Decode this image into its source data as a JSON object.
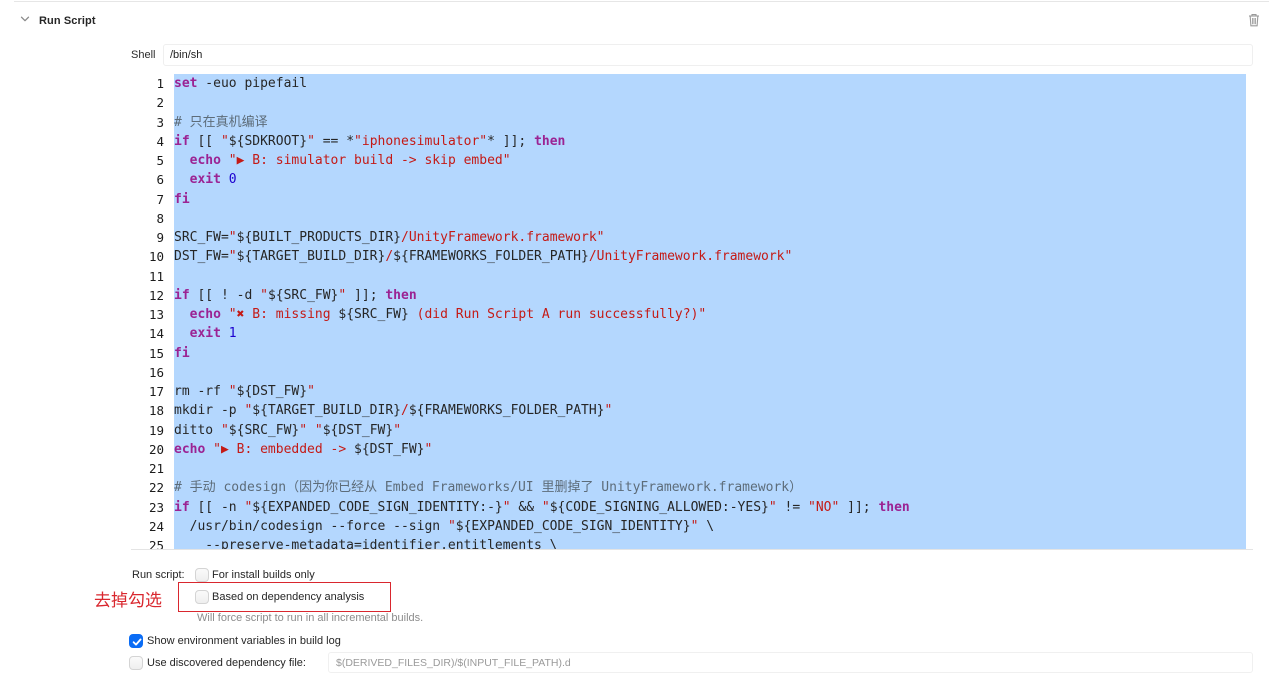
{
  "phase": {
    "title": "Run Script"
  },
  "shell": {
    "label": "Shell",
    "value": "/bin/sh"
  },
  "editor": {
    "lines": [
      [
        {
          "t": "set",
          "c": "kw"
        },
        {
          "t": " -euo pipefail"
        }
      ],
      [],
      [
        {
          "t": "# 只在真机编译",
          "c": "cmt"
        }
      ],
      [
        {
          "t": "if",
          "c": "kw"
        },
        {
          "t": " [[ "
        },
        {
          "t": "\"",
          "c": "str"
        },
        {
          "t": "${SDKROOT}"
        },
        {
          "t": "\"",
          "c": "str"
        },
        {
          "t": " == *"
        },
        {
          "t": "\"iphonesimulator\"",
          "c": "str"
        },
        {
          "t": "* ]]; "
        },
        {
          "t": "then",
          "c": "kw"
        }
      ],
      [
        {
          "t": "  "
        },
        {
          "t": "echo",
          "c": "kw"
        },
        {
          "t": " "
        },
        {
          "t": "\"▶ B: simulator build -> skip embed\"",
          "c": "str"
        }
      ],
      [
        {
          "t": "  "
        },
        {
          "t": "exit",
          "c": "kw"
        },
        {
          "t": " "
        },
        {
          "t": "0",
          "c": "num"
        }
      ],
      [
        {
          "t": "fi",
          "c": "kw"
        }
      ],
      [],
      [
        {
          "t": "SRC_FW="
        },
        {
          "t": "\"",
          "c": "str"
        },
        {
          "t": "${BUILT_PRODUCTS_DIR}"
        },
        {
          "t": "/UnityFramework.framework\"",
          "c": "str"
        }
      ],
      [
        {
          "t": "DST_FW="
        },
        {
          "t": "\"",
          "c": "str"
        },
        {
          "t": "${TARGET_BUILD_DIR}"
        },
        {
          "t": "/",
          "c": "str"
        },
        {
          "t": "${FRAMEWORKS_FOLDER_PATH}"
        },
        {
          "t": "/UnityFramework.framework\"",
          "c": "str"
        }
      ],
      [],
      [
        {
          "t": "if",
          "c": "kw"
        },
        {
          "t": " [[ ! -d "
        },
        {
          "t": "\"",
          "c": "str"
        },
        {
          "t": "${SRC_FW}"
        },
        {
          "t": "\"",
          "c": "str"
        },
        {
          "t": " ]]; "
        },
        {
          "t": "then",
          "c": "kw"
        }
      ],
      [
        {
          "t": "  "
        },
        {
          "t": "echo",
          "c": "kw"
        },
        {
          "t": " "
        },
        {
          "t": "\"✖ B: missing ",
          "c": "str"
        },
        {
          "t": "${SRC_FW}"
        },
        {
          "t": " (did Run Script A run successfully?)\"",
          "c": "str"
        }
      ],
      [
        {
          "t": "  "
        },
        {
          "t": "exit",
          "c": "kw"
        },
        {
          "t": " "
        },
        {
          "t": "1",
          "c": "num"
        }
      ],
      [
        {
          "t": "fi",
          "c": "kw"
        }
      ],
      [],
      [
        {
          "t": "rm -rf "
        },
        {
          "t": "\"",
          "c": "str"
        },
        {
          "t": "${DST_FW}"
        },
        {
          "t": "\"",
          "c": "str"
        }
      ],
      [
        {
          "t": "mkdir -p "
        },
        {
          "t": "\"",
          "c": "str"
        },
        {
          "t": "${TARGET_BUILD_DIR}"
        },
        {
          "t": "/",
          "c": "str"
        },
        {
          "t": "${FRAMEWORKS_FOLDER_PATH}"
        },
        {
          "t": "\"",
          "c": "str"
        }
      ],
      [
        {
          "t": "ditto "
        },
        {
          "t": "\"",
          "c": "str"
        },
        {
          "t": "${SRC_FW}"
        },
        {
          "t": "\"",
          "c": "str"
        },
        {
          "t": " "
        },
        {
          "t": "\"",
          "c": "str"
        },
        {
          "t": "${DST_FW}"
        },
        {
          "t": "\"",
          "c": "str"
        }
      ],
      [
        {
          "t": "echo",
          "c": "kw"
        },
        {
          "t": " "
        },
        {
          "t": "\"▶ B: embedded -> ",
          "c": "str"
        },
        {
          "t": "${DST_FW}"
        },
        {
          "t": "\"",
          "c": "str"
        }
      ],
      [],
      [
        {
          "t": "# 手动 codesign（因为你已经从 Embed Frameworks/UI 里删掉了 UnityFramework.framework）",
          "c": "cmt"
        }
      ],
      [
        {
          "t": "if",
          "c": "kw"
        },
        {
          "t": " [[ -n "
        },
        {
          "t": "\"",
          "c": "str"
        },
        {
          "t": "${EXPANDED_CODE_SIGN_IDENTITY:-}"
        },
        {
          "t": "\"",
          "c": "str"
        },
        {
          "t": " && "
        },
        {
          "t": "\"",
          "c": "str"
        },
        {
          "t": "${CODE_SIGNING_ALLOWED:-YES}"
        },
        {
          "t": "\"",
          "c": "str"
        },
        {
          "t": " != "
        },
        {
          "t": "\"NO\"",
          "c": "str"
        },
        {
          "t": " ]]; "
        },
        {
          "t": "then",
          "c": "kw"
        }
      ],
      [
        {
          "t": "  /usr/bin/codesign --force --sign "
        },
        {
          "t": "\"",
          "c": "str"
        },
        {
          "t": "${EXPANDED_CODE_SIGN_IDENTITY}"
        },
        {
          "t": "\"",
          "c": "str"
        },
        {
          "t": " \\"
        }
      ],
      [
        {
          "t": "    --preserve-metadata=identifier,entitlements \\"
        }
      ]
    ]
  },
  "options": {
    "run_script_label": "Run script:",
    "install_builds_label": "For install builds only",
    "install_builds_checked": false,
    "dependency_analysis_label": "Based on dependency analysis",
    "dependency_analysis_checked": false,
    "dependency_hint": "Will force script to run in all incremental builds.",
    "show_env_label": "Show environment variables in build log",
    "show_env_checked": true,
    "use_dep_file_label": "Use discovered dependency file:",
    "use_dep_file_checked": false,
    "dep_file_placeholder": "$(DERIVED_FILES_DIR)/$(INPUT_FILE_PATH).d"
  },
  "annotation": {
    "text": "去掉勾选",
    "color": "#d9272e"
  }
}
